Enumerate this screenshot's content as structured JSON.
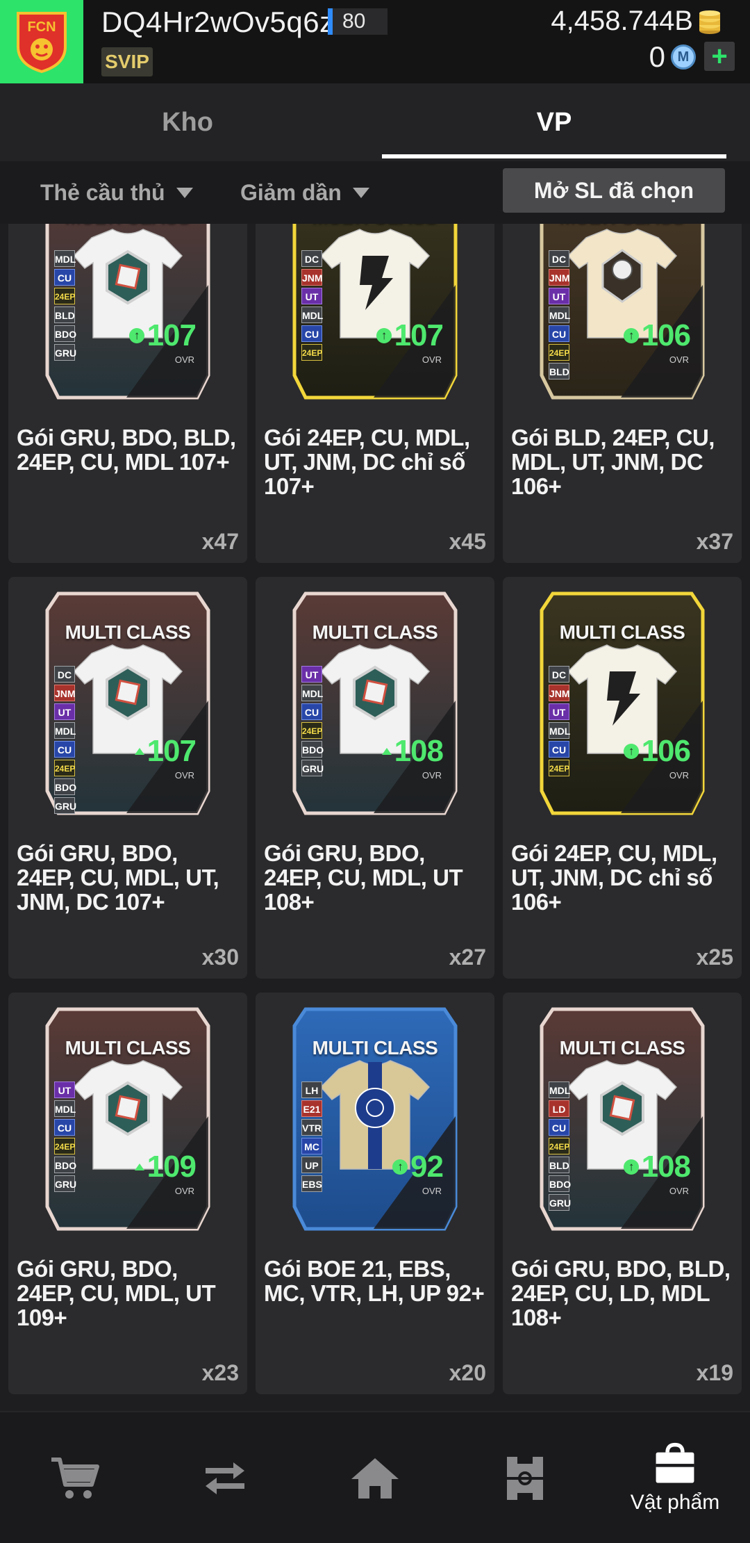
{
  "header": {
    "username": "DQ4Hr2wOv5q6z",
    "level": "80",
    "vip_label": "SVIP",
    "coins": "4,458.744B",
    "mcoin": "0",
    "mcoin_symbol": "M",
    "add_symbol": "+",
    "logo_icon": "club-crest-icon",
    "logo_color": "#2de36a"
  },
  "tabs": [
    {
      "label": "Kho",
      "active": false
    },
    {
      "label": "VP",
      "active": true
    }
  ],
  "filters": {
    "type_label": "Thẻ cầu thủ",
    "sort_label": "Giảm dần",
    "open_selected_label": "Mở SL đã chọn"
  },
  "card_common": {
    "title": "MULTI CLASS",
    "ovr_label": "OVR"
  },
  "items": [
    {
      "name": "Gói GRU, BDO, BLD, 24EP, CU, MDL 107+",
      "qty": "x47",
      "ovr": "107",
      "style": "chrome",
      "positions": [
        "MDL",
        "CU",
        "24EP",
        "BLD",
        "BDO",
        "GRU"
      ]
    },
    {
      "name": "Gói 24EP, CU, MDL, UT, JNM, DC chỉ số 107+",
      "qty": "x45",
      "ovr": "107",
      "style": "gold",
      "positions": [
        "DC",
        "JNM",
        "UT",
        "MDL",
        "CU",
        "24EP"
      ]
    },
    {
      "name": "Gói BLD, 24EP, CU, MDL, UT, JNM, DC 106+",
      "qty": "x37",
      "ovr": "106",
      "style": "cream",
      "positions": [
        "DC",
        "JNM",
        "UT",
        "MDL",
        "CU",
        "24EP",
        "BLD"
      ]
    },
    {
      "name": "Gói GRU, BDO, 24EP, CU, MDL, UT, JNM, DC 107+",
      "qty": "x30",
      "ovr": "107",
      "style": "chrome",
      "positions": [
        "DC",
        "JNM",
        "UT",
        "MDL",
        "CU",
        "24EP",
        "BDO",
        "GRU"
      ]
    },
    {
      "name": "Gói GRU, BDO, 24EP, CU, MDL, UT 108+",
      "qty": "x27",
      "ovr": "108",
      "style": "chrome",
      "positions": [
        "UT",
        "MDL",
        "CU",
        "24EP",
        "BDO",
        "GRU"
      ]
    },
    {
      "name": "Gói 24EP, CU, MDL, UT, JNM, DC chỉ số 106+",
      "qty": "x25",
      "ovr": "106",
      "style": "gold",
      "positions": [
        "DC",
        "JNM",
        "UT",
        "MDL",
        "CU",
        "24EP"
      ]
    },
    {
      "name": "Gói GRU, BDO, 24EP, CU, MDL, UT 109+",
      "qty": "x23",
      "ovr": "109",
      "style": "chrome",
      "positions": [
        "UT",
        "MDL",
        "CU",
        "24EP",
        "BDO",
        "GRU"
      ]
    },
    {
      "name": "Gói BOE 21, EBS, MC, VTR, LH, UP 92+",
      "qty": "x20",
      "ovr": "92",
      "style": "blue",
      "positions": [
        "LH",
        "E21",
        "VTR",
        "MC",
        "UP",
        "EBS"
      ]
    },
    {
      "name": "Gói GRU, BDO, BLD, 24EP, CU, LD, MDL 108+",
      "qty": "x19",
      "ovr": "108",
      "style": "chrome",
      "positions": [
        "MDL",
        "LD",
        "CU",
        "24EP",
        "BLD",
        "BDO",
        "GRU"
      ]
    }
  ],
  "bottom_nav": [
    {
      "icon": "cart-icon",
      "label": "",
      "active": false
    },
    {
      "icon": "transfer-icon",
      "label": "",
      "active": false
    },
    {
      "icon": "home-icon",
      "label": "",
      "active": false
    },
    {
      "icon": "field-icon",
      "label": "",
      "active": false
    },
    {
      "icon": "bag-icon",
      "label": "Vật phẩm",
      "active": true
    }
  ],
  "colors": {
    "background": "#1e1e20",
    "card_bg": "#2b2b2d",
    "ovr_green": "#4ee86e",
    "accent_green": "#2de36a"
  }
}
